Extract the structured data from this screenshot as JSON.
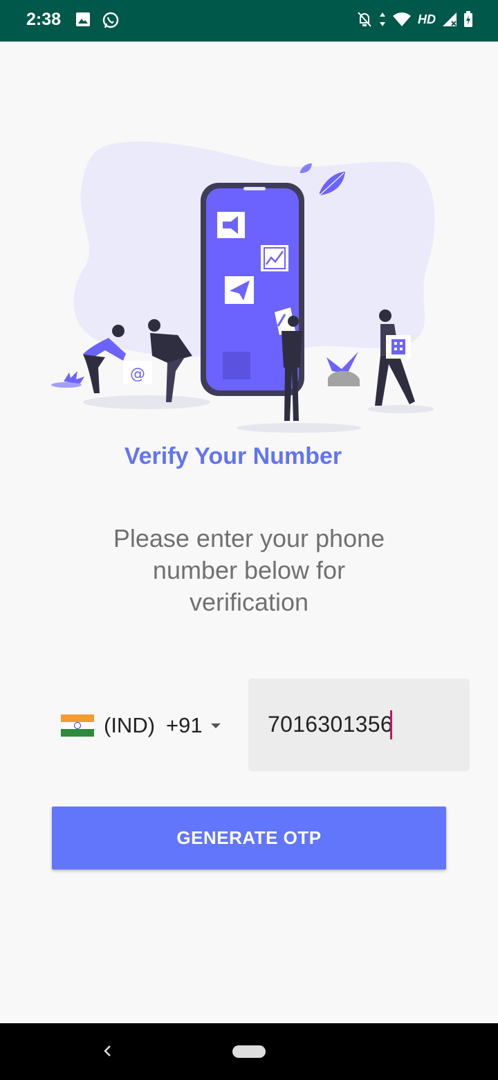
{
  "status_bar": {
    "time": "2:38",
    "network_label": "HD",
    "icons": [
      "image-icon",
      "whatsapp-icon",
      "notifications-off-icon",
      "data-arrows-icon",
      "wifi-icon",
      "cellular-signal-icon",
      "battery-charging-icon"
    ]
  },
  "illustration": {
    "name": "phone-verification-illustration",
    "accent_color": "#6c63ff",
    "icons": [
      "megaphone-icon",
      "chart-icon",
      "paper-plane-icon",
      "at-sign-icon",
      "building-icon",
      "leaf-icon"
    ]
  },
  "title": "Verify Your Number",
  "subtitle": "Please enter your phone number below for verification",
  "country_picker": {
    "country": "(IND)",
    "dial_code": "+91",
    "flag_icon": "india-flag-icon"
  },
  "phone_input": {
    "value": "7016301356"
  },
  "generate_button": {
    "label": "GENERATE OTP",
    "color": "#6176fa"
  },
  "nav_bar": {
    "icons": [
      "back-icon",
      "home-pill-icon"
    ]
  },
  "colors": {
    "status_bar": "#00584a",
    "title": "#6273f3",
    "background": "#f8f8f8",
    "cursor": "#c2185b"
  }
}
